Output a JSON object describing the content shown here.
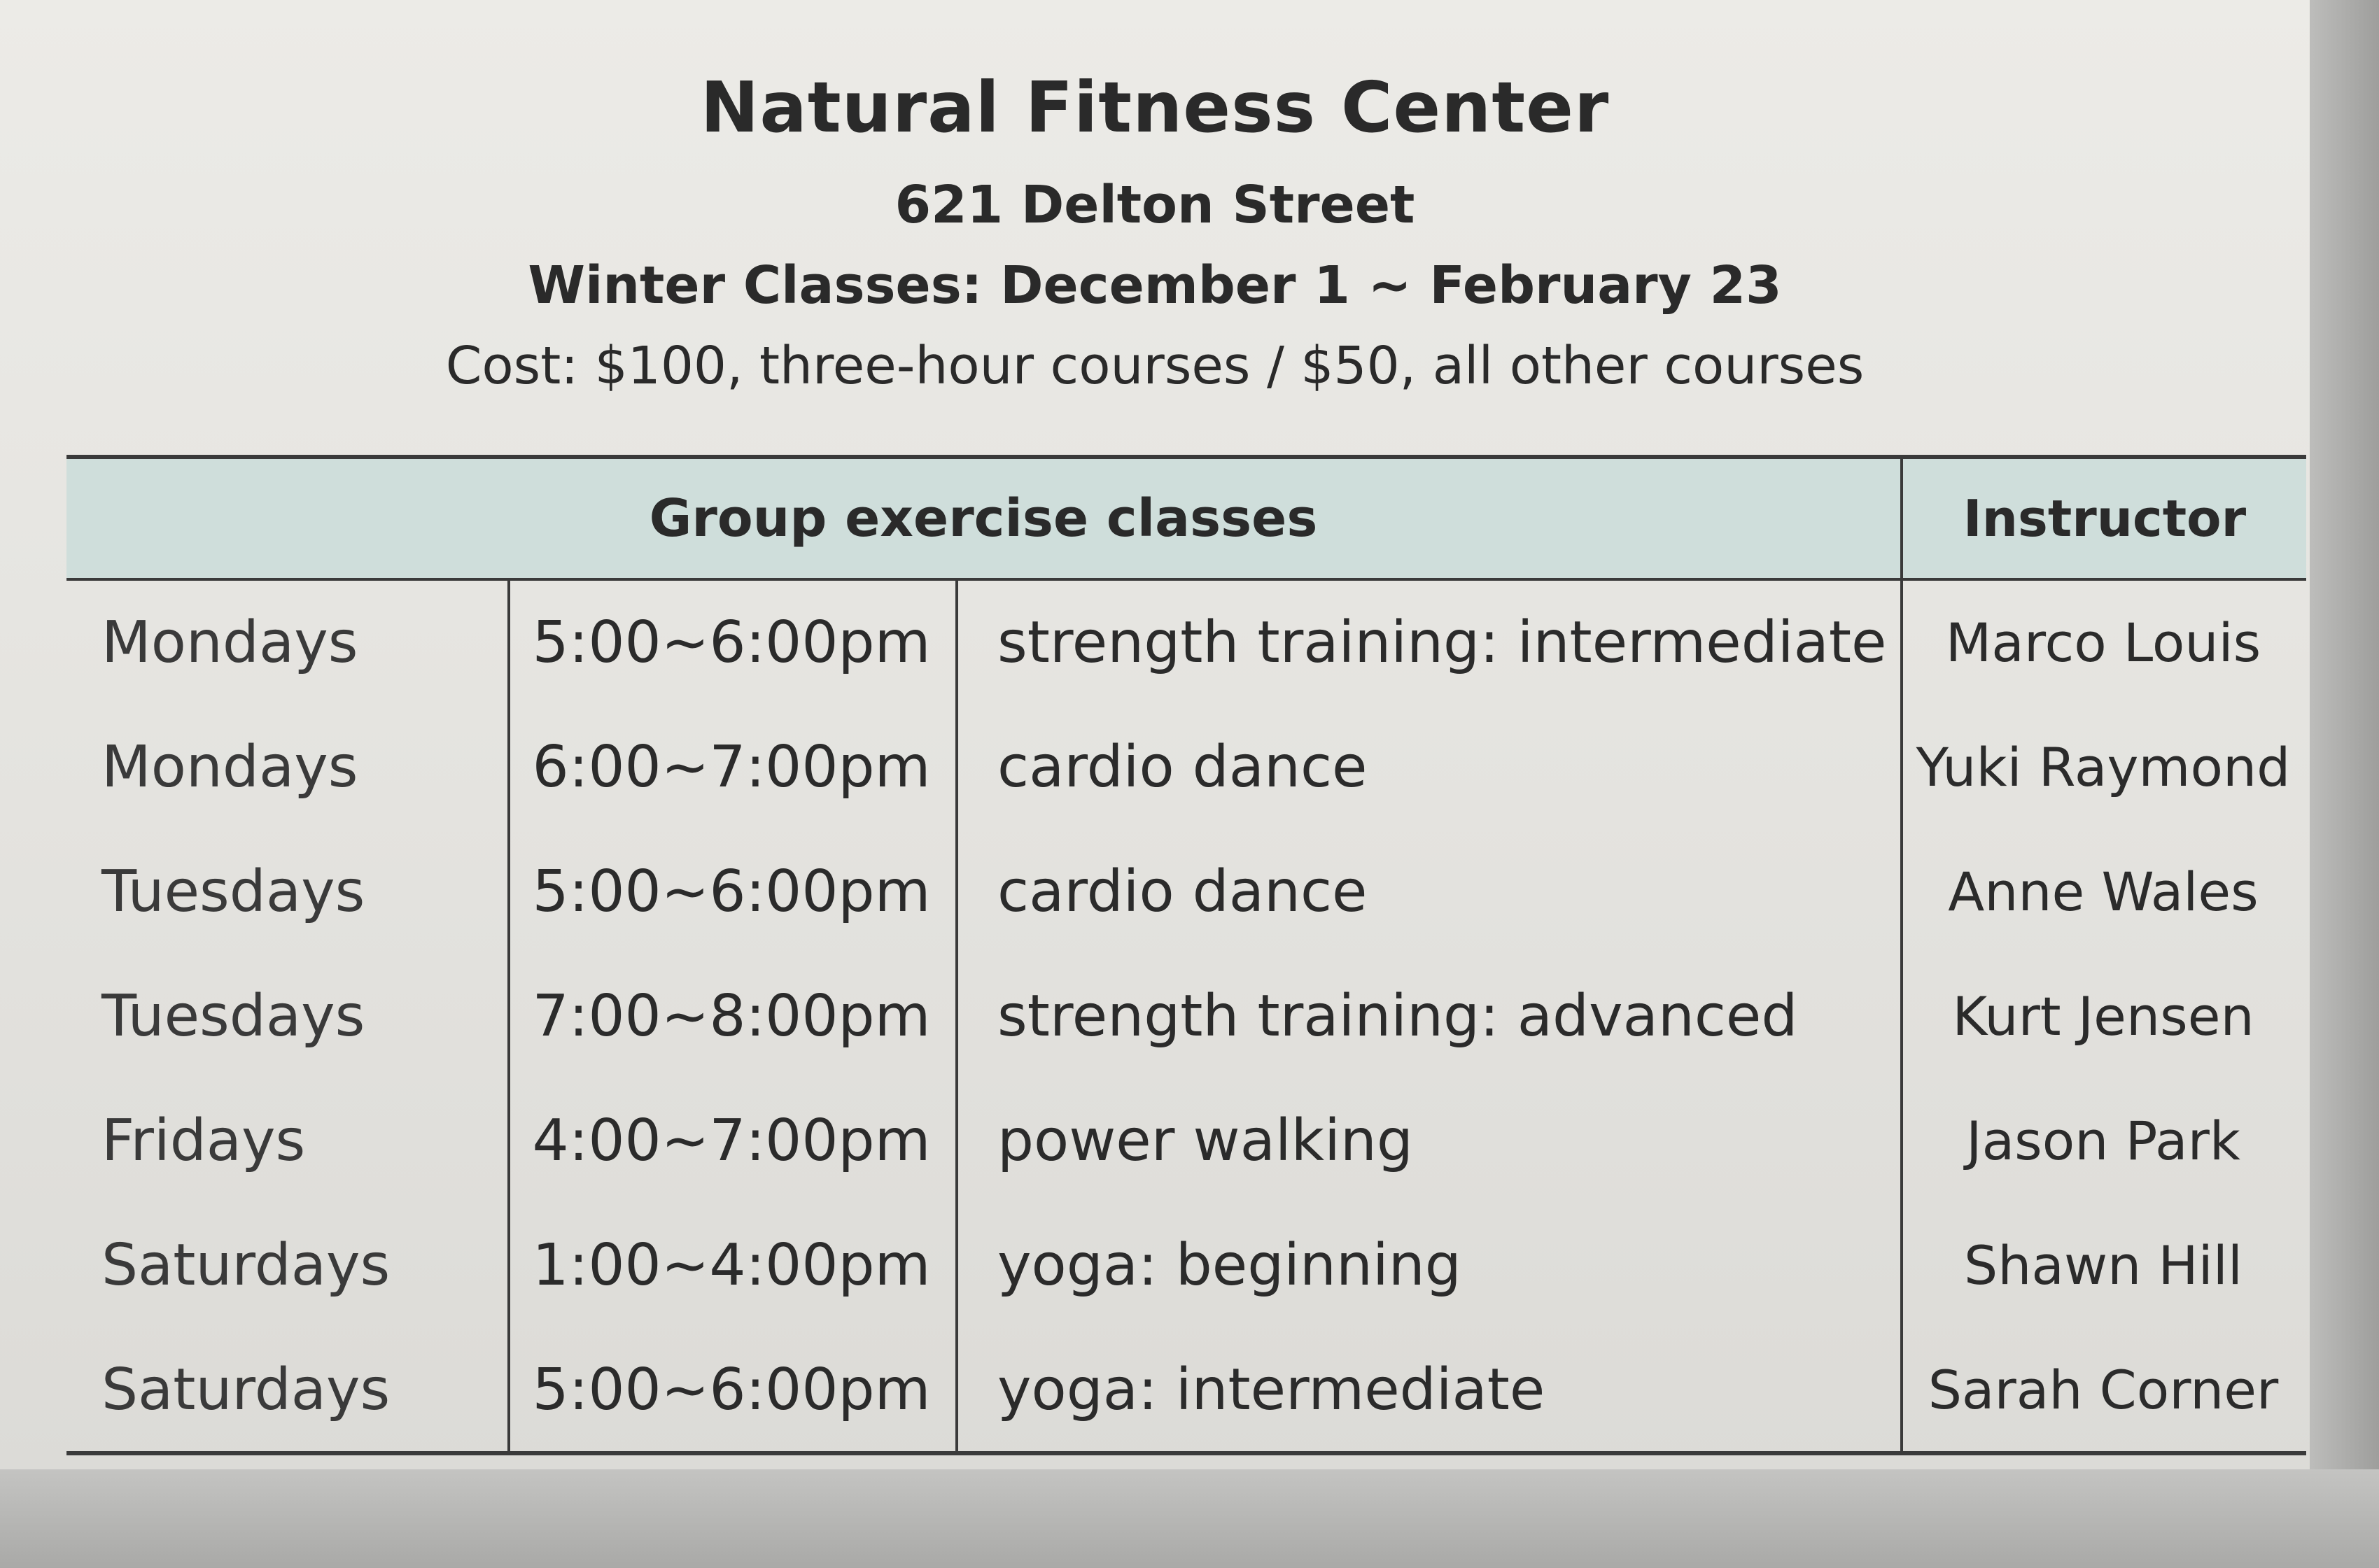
{
  "header": {
    "title": "Natural Fitness Center",
    "address": "621 Delton Street",
    "dates": "Winter Classes: December 1 ~ February 23",
    "cost": "Cost: $100, three-hour courses / $50, all other courses"
  },
  "table": {
    "headers": {
      "group": "Group exercise classes",
      "instructor": "Instructor"
    },
    "rows": [
      {
        "day": "Mondays",
        "time": "5:00~6:00pm",
        "class": "strength training: intermediate",
        "instructor": "Marco Louis"
      },
      {
        "day": "Mondays",
        "time": "6:00~7:00pm",
        "class": "cardio dance",
        "instructor": "Yuki Raymond"
      },
      {
        "day": "Tuesdays",
        "time": "5:00~6:00pm",
        "class": "cardio dance",
        "instructor": "Anne Wales"
      },
      {
        "day": "Tuesdays",
        "time": "7:00~8:00pm",
        "class": "strength training: advanced",
        "instructor": "Kurt Jensen"
      },
      {
        "day": "Fridays",
        "time": "4:00~7:00pm",
        "class": "power walking",
        "instructor": "Jason Park"
      },
      {
        "day": "Saturdays",
        "time": "1:00~4:00pm",
        "class": "yoga: beginning",
        "instructor": "Shawn Hill"
      },
      {
        "day": "Saturdays",
        "time": "5:00~6:00pm",
        "class": "yoga: intermediate",
        "instructor": "Sarah Corner"
      }
    ]
  }
}
